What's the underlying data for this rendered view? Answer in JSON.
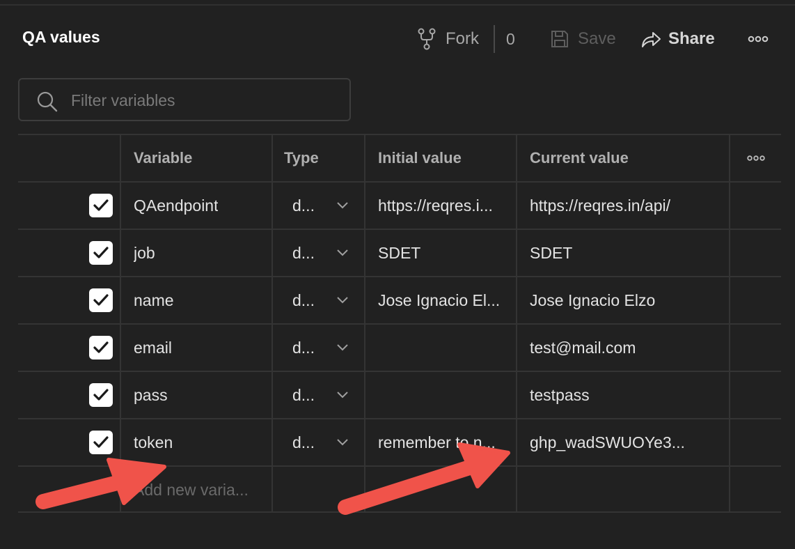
{
  "header": {
    "title": "QA values",
    "fork_label": "Fork",
    "fork_count": "0",
    "save_label": "Save",
    "share_label": "Share"
  },
  "search": {
    "placeholder": "Filter variables",
    "value": ""
  },
  "table": {
    "columns": [
      "Variable",
      "Type",
      "Initial value",
      "Current value"
    ],
    "rows": [
      {
        "checked": true,
        "variable": "QAendpoint",
        "type": "d...",
        "initial": "https://reqres.i...",
        "current": "https://reqres.in/api/"
      },
      {
        "checked": true,
        "variable": "job",
        "type": "d...",
        "initial": "SDET",
        "current": "SDET"
      },
      {
        "checked": true,
        "variable": "name",
        "type": "d...",
        "initial": "Jose Ignacio El...",
        "current": "Jose Ignacio Elzo"
      },
      {
        "checked": true,
        "variable": "email",
        "type": "d...",
        "initial": "",
        "current": "test@mail.com"
      },
      {
        "checked": true,
        "variable": "pass",
        "type": "d...",
        "initial": "",
        "current": "testpass"
      },
      {
        "checked": true,
        "variable": "token",
        "type": "d...",
        "initial": "remember to n...",
        "current": "ghp_wadSWUOYe3..."
      }
    ],
    "add_placeholder": "Add new varia..."
  },
  "colors": {
    "background": "#212121",
    "annotation_arrow": "#f0534a",
    "checkbox_fill": "#ffffff"
  },
  "icons": [
    "fork-icon",
    "save-icon",
    "share-icon",
    "more-icon",
    "search-icon",
    "check-icon",
    "chevron-down-icon"
  ]
}
